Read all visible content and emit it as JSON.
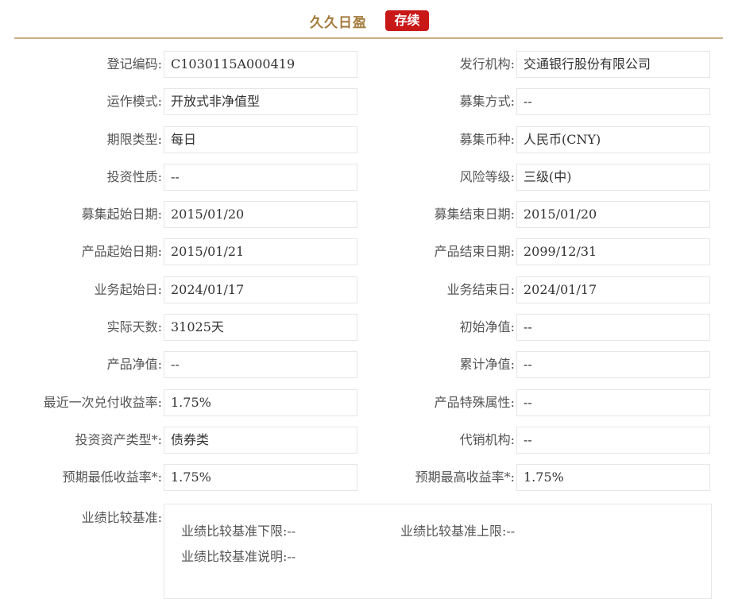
{
  "header": {
    "product_name": "久久日盈",
    "status": "存续"
  },
  "rows": [
    {
      "left_label": "登记编码:",
      "left_value": "C1030115A000419",
      "right_label": "发行机构:",
      "right_value": "交通银行股份有限公司"
    },
    {
      "left_label": "运作模式:",
      "left_value": "开放式非净值型",
      "right_label": "募集方式:",
      "right_value": "--"
    },
    {
      "left_label": "期限类型:",
      "left_value": "每日",
      "right_label": "募集币种:",
      "right_value": "人民币(CNY)"
    },
    {
      "left_label": "投资性质:",
      "left_value": "--",
      "right_label": "风险等级:",
      "right_value": "三级(中)"
    },
    {
      "left_label": "募集起始日期:",
      "left_value": "2015/01/20",
      "right_label": "募集结束日期:",
      "right_value": "2015/01/20"
    },
    {
      "left_label": "产品起始日期:",
      "left_value": "2015/01/21",
      "right_label": "产品结束日期:",
      "right_value": "2099/12/31"
    },
    {
      "left_label": "业务起始日:",
      "left_value": "2024/01/17",
      "right_label": "业务结束日:",
      "right_value": "2024/01/17"
    },
    {
      "left_label": "实际天数:",
      "left_value": "31025天",
      "right_label": "初始净值:",
      "right_value": "--"
    },
    {
      "left_label": "产品净值:",
      "left_value": "--",
      "right_label": "累计净值:",
      "right_value": "--"
    },
    {
      "left_label": "最近一次兑付收益率:",
      "left_value": "1.75%",
      "right_label": "产品特殊属性:",
      "right_value": "--"
    },
    {
      "left_label": "投资资产类型*:",
      "left_value": "债券类",
      "right_label": "代销机构:",
      "right_value": "--"
    },
    {
      "left_label": "预期最低收益率*:",
      "left_value": "1.75%",
      "right_label": "预期最高收益率*:",
      "right_value": "1.75%"
    }
  ],
  "benchmark": {
    "label": "业绩比较基准:",
    "lower_limit": "业绩比较基准下限:--",
    "upper_limit": "业绩比较基准上限:--",
    "description": "业绩比较基准说明:--"
  }
}
